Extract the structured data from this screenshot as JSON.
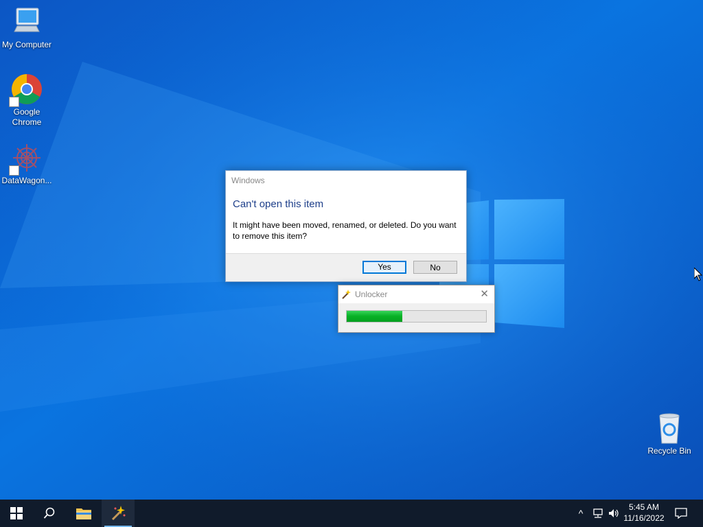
{
  "desktop": {
    "icons": [
      {
        "label": "My Computer",
        "icon": "computer-icon"
      },
      {
        "label": "Google Chrome",
        "icon": "chrome-icon"
      },
      {
        "label": "DataWagon...",
        "icon": "datawagon-icon"
      },
      {
        "label": "Recycle Bin",
        "icon": "recycle-bin-icon"
      }
    ]
  },
  "dialog": {
    "window_title": "Windows",
    "heading": "Can't open this item",
    "message": "It might have been moved, renamed, or deleted. Do you want to remove this item?",
    "yes_label": "Yes",
    "no_label": "No"
  },
  "unlocker": {
    "window_title": "Unlocker",
    "close_glyph": "✕",
    "progress_fraction": 0.4
  },
  "taskbar": {
    "time": "5:45 AM",
    "date": "11/16/2022",
    "tray_chevron": "^"
  },
  "colors": {
    "accent": "#0078d7",
    "progress_green": "#06b025",
    "taskbar_bg": "#101b2b",
    "wallpaper_blue": "#0a5fd0"
  }
}
